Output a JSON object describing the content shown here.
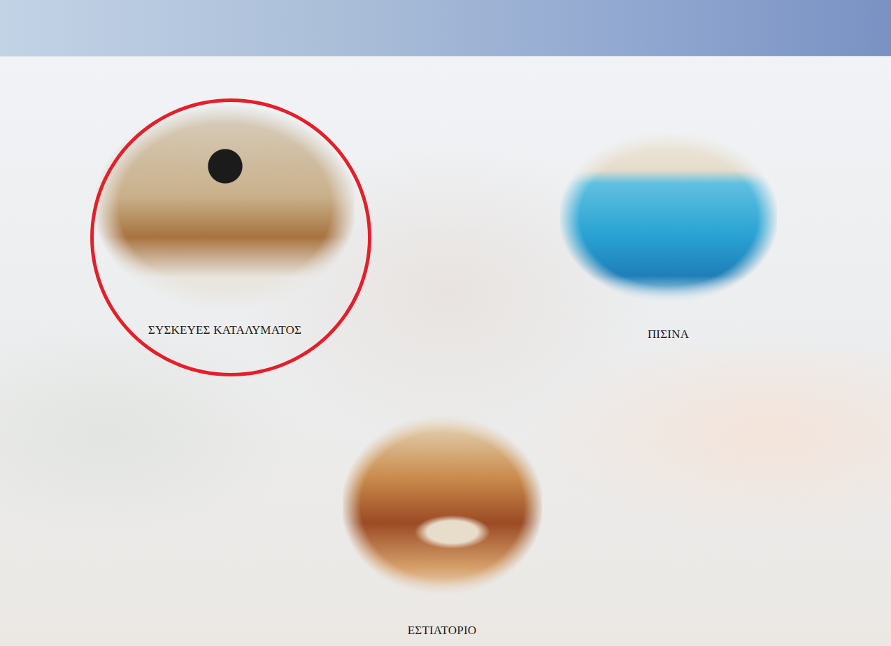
{
  "facilities": [
    {
      "label": "ΣΥΣΚΕΥΕΣ ΚΑΤΑΛΥΜΑΤΟΣ",
      "highlighted": true
    },
    {
      "label": "ΠΙΣΙΝΑ",
      "highlighted": false
    },
    {
      "label": "ΕΣΤΙΑΤΟΡΙΟ",
      "highlighted": false
    }
  ]
}
